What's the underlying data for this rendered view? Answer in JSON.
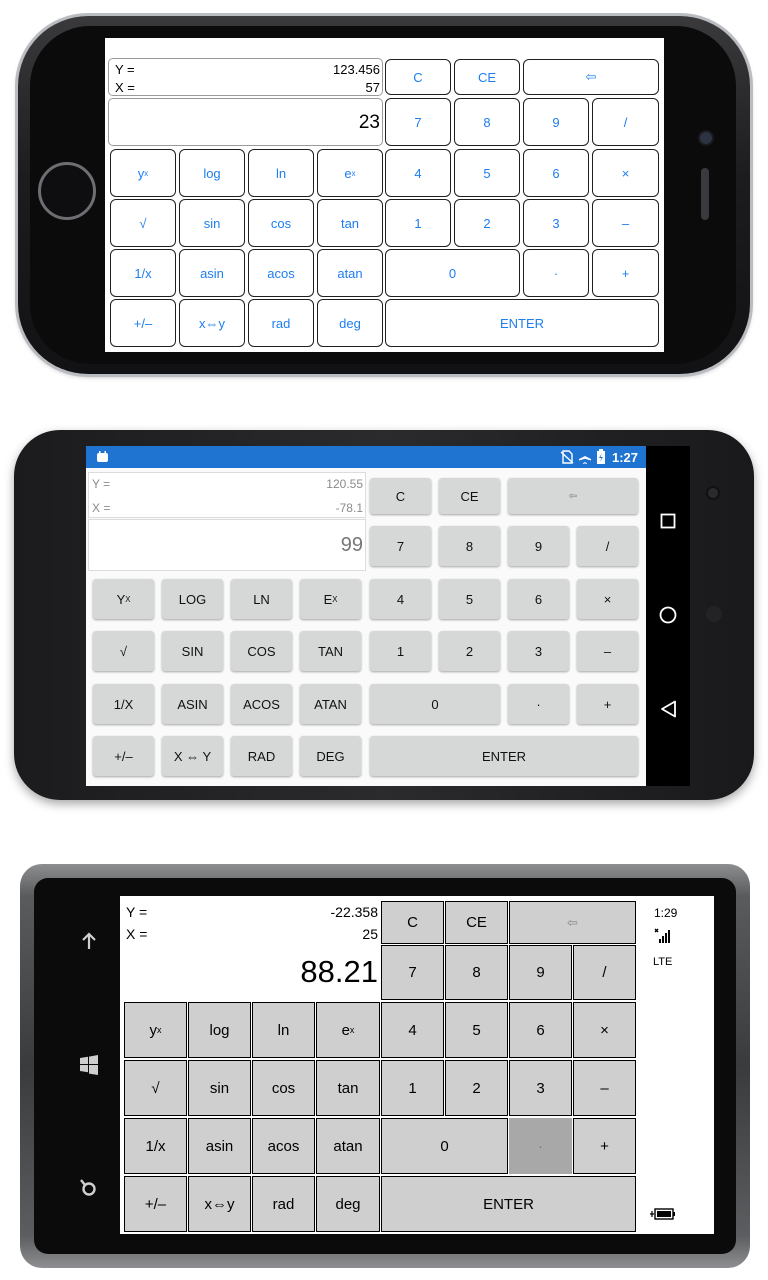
{
  "ios": {
    "registers": {
      "y_label": "Y =",
      "y_value": "123.456",
      "x_label": "X =",
      "x_value": "57",
      "display": "23"
    },
    "keys": {
      "c": "C",
      "ce": "CE",
      "back": "⇦",
      "seven": "7",
      "eight": "8",
      "nine": "9",
      "div": "/",
      "yx_base": "y",
      "yx_sup": "x",
      "log": "log",
      "ln": "ln",
      "ex_base": "e",
      "ex_sup": "x",
      "four": "4",
      "five": "5",
      "six": "6",
      "mul": "×",
      "sqrt": "√",
      "sin": "sin",
      "cos": "cos",
      "tan": "tan",
      "one": "1",
      "two": "2",
      "three": "3",
      "minus": "–",
      "inv": "1/x",
      "asin": "asin",
      "acos": "acos",
      "atan": "atan",
      "zero": "0",
      "dot": "·",
      "plus": "+",
      "neg": "+/–",
      "swap": "x⇔y",
      "rad": "rad",
      "deg": "deg",
      "enter": "ENTER"
    }
  },
  "android": {
    "status": {
      "time": "1:27"
    },
    "registers": {
      "y_label": "Y =",
      "y_value": "120.55",
      "x_label": "X =",
      "x_value": "-78.1",
      "display": "99"
    },
    "keys": {
      "c": "C",
      "ce": "CE",
      "back": "⇦",
      "seven": "7",
      "eight": "8",
      "nine": "9",
      "div": "/",
      "yx_base": "Y",
      "yx_sup": "X",
      "log": "LOG",
      "ln": "LN",
      "ex_base": "E",
      "ex_sup": "X",
      "four": "4",
      "five": "5",
      "six": "6",
      "mul": "×",
      "sqrt": "√",
      "sin": "SIN",
      "cos": "COS",
      "tan": "TAN",
      "one": "1",
      "two": "2",
      "three": "3",
      "minus": "–",
      "inv": "1/X",
      "asin": "ASIN",
      "acos": "ACOS",
      "atan": "ATAN",
      "zero": "0",
      "dot": "·",
      "plus": "+",
      "neg": "+/–",
      "swap": "X ⇔ Y",
      "rad": "RAD",
      "deg": "DEG",
      "enter": "ENTER"
    }
  },
  "windows": {
    "status": {
      "time": "1:29",
      "network": "LTE"
    },
    "registers": {
      "y_label": "Y =",
      "y_value": "-22.358",
      "x_label": "X =",
      "x_value": "25",
      "display": "88.21"
    },
    "keys": {
      "c": "C",
      "ce": "CE",
      "back": "⇦",
      "seven": "7",
      "eight": "8",
      "nine": "9",
      "div": "/",
      "yx_base": "y",
      "yx_sup": "x",
      "log": "log",
      "ln": "ln",
      "ex_base": "e",
      "ex_sup": "x",
      "four": "4",
      "five": "5",
      "six": "6",
      "mul": "×",
      "sqrt": "√",
      "sin": "sin",
      "cos": "cos",
      "tan": "tan",
      "one": "1",
      "two": "2",
      "three": "3",
      "minus": "–",
      "inv": "1/x",
      "asin": "asin",
      "acos": "acos",
      "atan": "atan",
      "zero": "0",
      "dot": "·",
      "plus": "+",
      "neg": "+/–",
      "swap": "x⇔y",
      "rad": "rad",
      "deg": "deg",
      "enter": "ENTER"
    }
  },
  "colors": {
    "ios_accent": "#1d7ef0",
    "android_status": "#1e74d0",
    "android_key": "#d6d7d7",
    "windows_key": "#cfcfcf",
    "windows_pressed": "#a8a8a8"
  },
  "icons": {
    "ios": [
      "home-button"
    ],
    "android": [
      "android-app-icon",
      "no-sim-icon",
      "airplane-icon",
      "battery-icon",
      "square-nav-icon",
      "circle-nav-icon",
      "back-triangle-icon"
    ],
    "windows": [
      "back-arrow-icon",
      "windows-start-icon",
      "search-icon",
      "signal-bars-icon",
      "battery-charging-icon"
    ]
  }
}
